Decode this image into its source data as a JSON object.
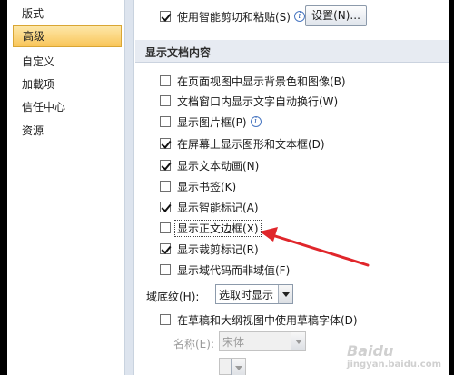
{
  "nav": {
    "items": [
      {
        "label": "版式"
      },
      {
        "label": "高级",
        "active": true
      },
      {
        "label": "自定义"
      },
      {
        "label": "加載项"
      },
      {
        "label": "信任中心"
      },
      {
        "label": "资源"
      }
    ]
  },
  "top": {
    "smart_cut_label": "使用智能剪切和粘贴(S)",
    "smart_cut_checked": true,
    "settings_button": "设置(N)..."
  },
  "section": {
    "title": "显示文档内容"
  },
  "options": [
    {
      "label": "在页面视图中显示背景色和图像(B)",
      "checked": false
    },
    {
      "label": "文档窗口内显示文字自动换行(W)",
      "checked": false
    },
    {
      "label": "显示图片框(P)",
      "checked": false
    },
    {
      "label": "在屏幕上显示图形和文本框(D)",
      "checked": true
    },
    {
      "label": "显示文本动画(N)",
      "checked": true
    },
    {
      "label": "显示书签(K)",
      "checked": false
    },
    {
      "label": "显示智能标记(A)",
      "checked": true
    },
    {
      "label": "显示正文边框(X)",
      "checked": false
    },
    {
      "label": "显示裁剪标记(R)",
      "checked": true
    },
    {
      "label": "显示域代码而非域值(F)",
      "checked": false
    }
  ],
  "field_shading": {
    "label": "域底纹(H):",
    "value": "选取时显示"
  },
  "draft_font": {
    "label": "在草稿和大纲视图中使用草稿字体(D)",
    "checked": false,
    "name_label": "名称(E):",
    "name_value": "宋体"
  },
  "watermark": {
    "text": "Baidu",
    "sub": "jingyan.baidu.com"
  },
  "colors": {
    "annotation_arrow": "#e0262b",
    "active_nav": "#f9c65a"
  }
}
